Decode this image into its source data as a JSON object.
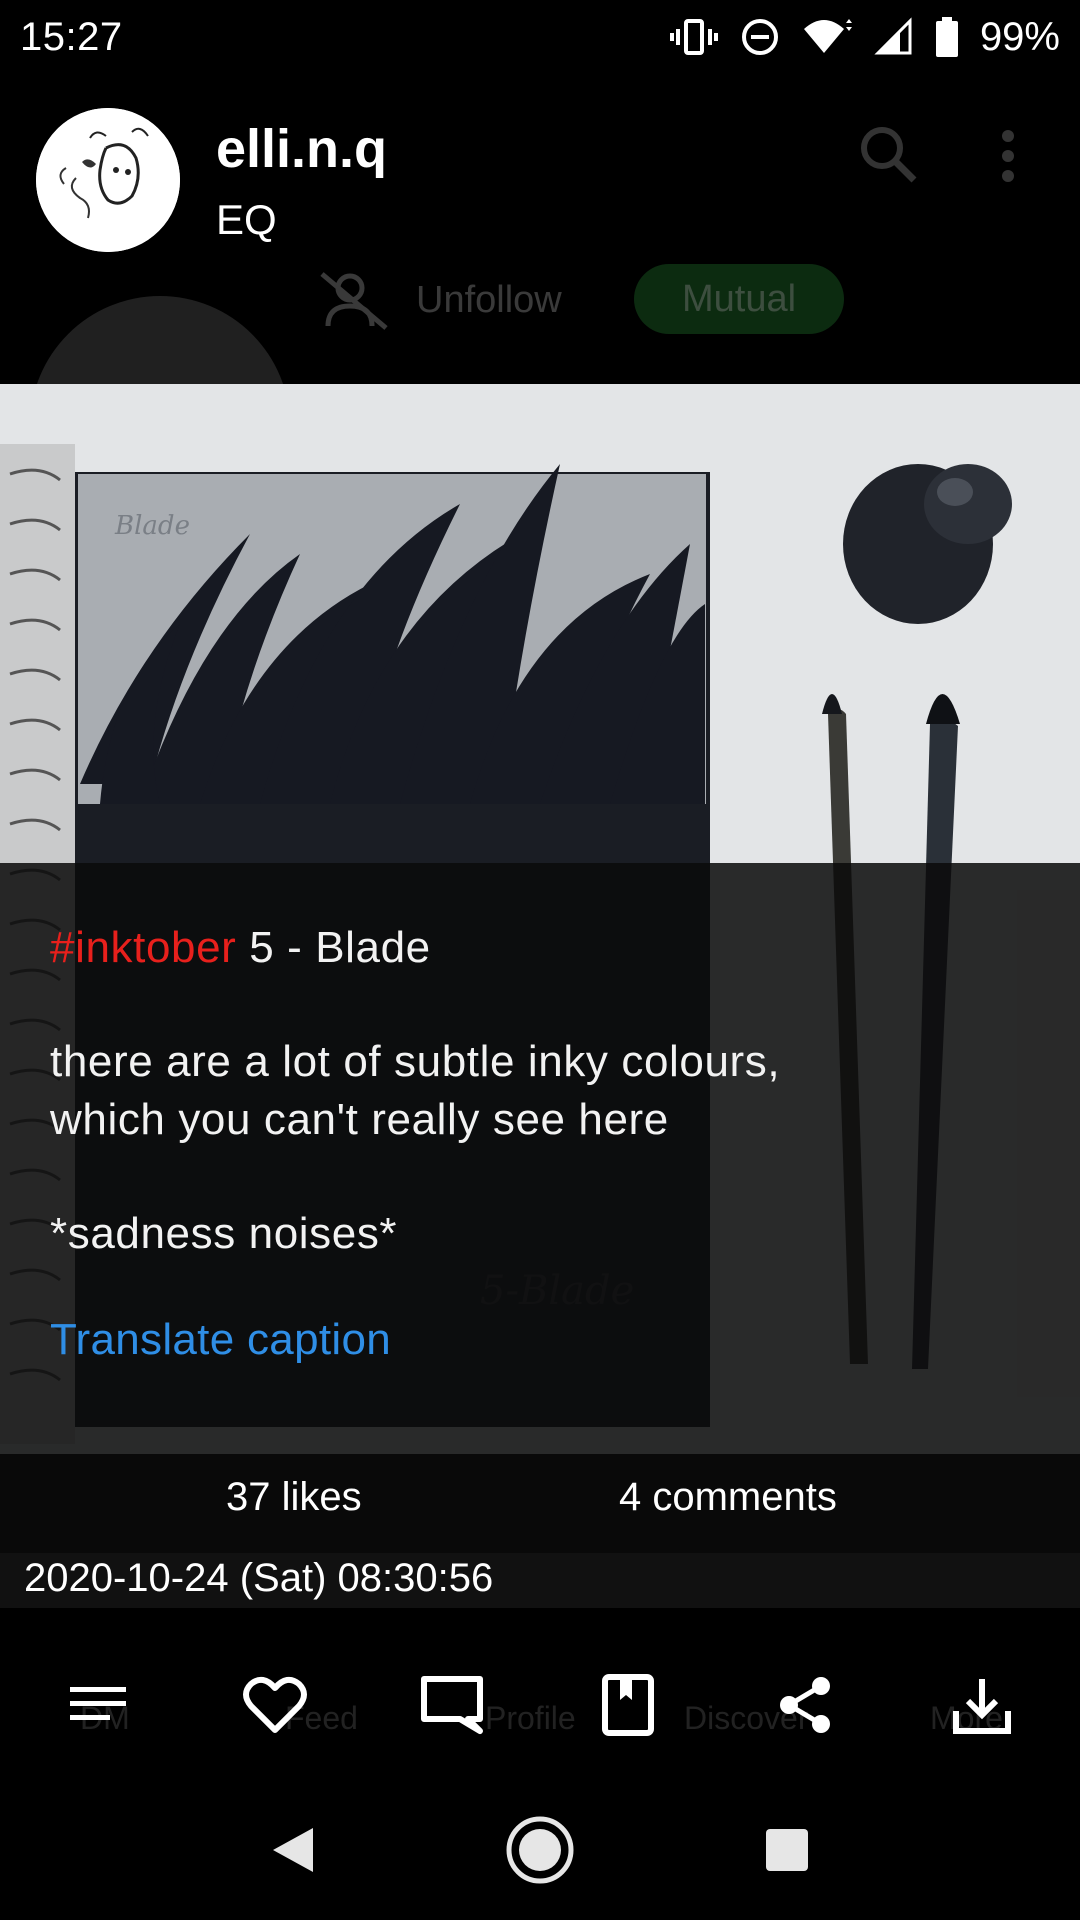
{
  "status_bar": {
    "time": "15:27",
    "battery": "99%",
    "icons": [
      "vibrate-icon",
      "do-not-disturb-icon",
      "wifi-icon",
      "cell-signal-icon",
      "battery-icon"
    ]
  },
  "header": {
    "title": "elli.n.q",
    "subtitle": "EQ"
  },
  "background_profile": {
    "unfollow_label": "Unfollow",
    "mutual_label": "Mutual"
  },
  "caption": {
    "hashtag": "#inktober",
    "title_rest": " 5 - Blade",
    "line1": "there are a lot of subtle inky colours,",
    "line2": "which you can't really see here",
    "line3": "*sadness noises*",
    "translate_label": "Translate caption"
  },
  "stats": {
    "likes": "37 likes",
    "comments": "4 comments"
  },
  "post": {
    "date": "2020-10-24 (Sat) 08:30:56"
  },
  "background_nav": {
    "items": [
      "DM",
      "Feed",
      "Profile",
      "Discover",
      "More"
    ]
  },
  "action_bar": {
    "icons": [
      "menu-icon",
      "heart-icon",
      "comment-icon",
      "bookmark-icon",
      "share-icon",
      "download-icon"
    ]
  },
  "system_nav": {
    "icons": [
      "back-icon",
      "home-icon",
      "recents-icon"
    ]
  },
  "colors": {
    "hashtag": "#e8201c",
    "link": "#2f8ee6",
    "background": "#000000"
  }
}
